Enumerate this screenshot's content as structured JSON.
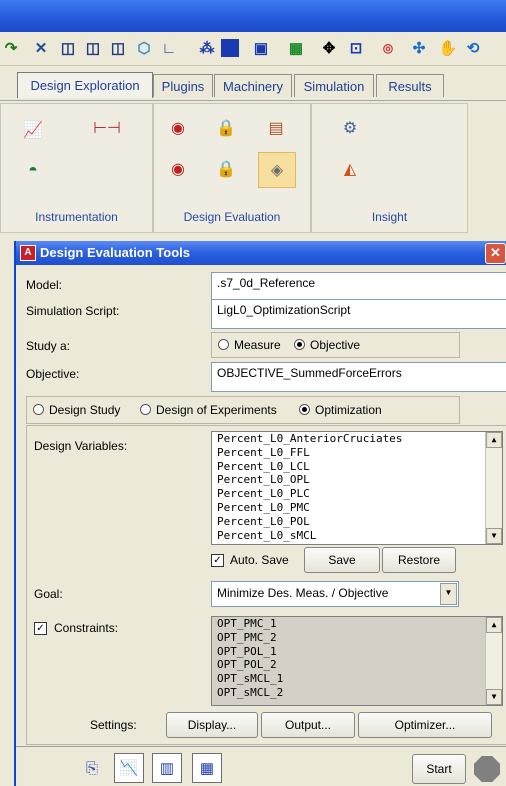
{
  "tabs": [
    "Design Exploration",
    "Plugins",
    "Machinery",
    "Simulation",
    "Results"
  ],
  "ribbon": {
    "groups": [
      "Instrumentation",
      "Design Evaluation",
      "Insight"
    ]
  },
  "dialog": {
    "title": "Design Evaluation Tools",
    "app_badge": "A",
    "close": "✕",
    "model_label": "Model:",
    "model_value": ".s7_0d_Reference",
    "script_label": "Simulation Script:",
    "script_value": "LigL0_OptimizationScript",
    "study_label": "Study a:",
    "study_options": [
      "Measure",
      "Objective"
    ],
    "objective_label": "Objective:",
    "objective_value": "OBJECTIVE_SummedForceErrors",
    "mode_options": [
      "Design Study",
      "Design of Experiments",
      "Optimization"
    ],
    "design_variables_label": "Design Variables:",
    "design_variables": [
      "Percent_L0_AnteriorCruciates",
      "Percent_L0_FFL",
      "Percent_L0_LCL",
      "Percent_L0_OPL",
      "Percent_L0_PLC",
      "Percent_L0_PMC",
      "Percent_L0_POL",
      "Percent_L0_sMCL"
    ],
    "auto_save_label": "Auto. Save",
    "save_button": "Save",
    "restore_button": "Restore",
    "goal_label": "Goal:",
    "goal_value": "Minimize Des. Meas. / Objective",
    "constraints_label": "Constraints:",
    "constraints": [
      "OPT_PMC_1",
      "OPT_PMC_2",
      "OPT_POL_1",
      "OPT_POL_2",
      "OPT_sMCL_1",
      "OPT_sMCL_2"
    ],
    "settings_label": "Settings:",
    "display_button": "Display...",
    "output_button": "Output...",
    "optimizer_button": "Optimizer...",
    "start_button": "Start"
  },
  "colors": {
    "title_blue": "#2a5fe0",
    "tab_text": "#1f3f9a"
  }
}
